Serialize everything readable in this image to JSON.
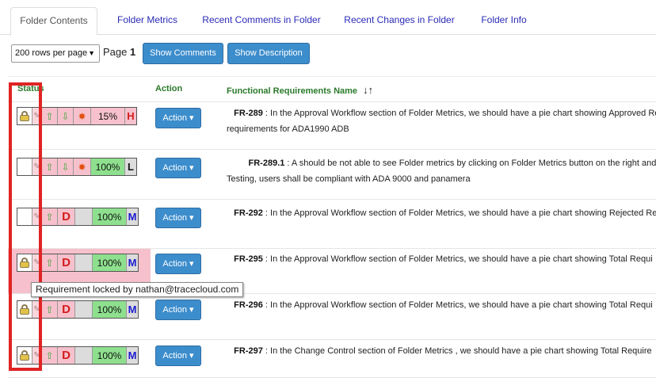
{
  "tabs": [
    {
      "label": "Folder Contents",
      "active": true
    },
    {
      "label": "Folder Metrics"
    },
    {
      "label": "Recent Comments in Folder"
    },
    {
      "label": "Recent Changes in Folder"
    },
    {
      "label": "Folder Info"
    }
  ],
  "toolbar": {
    "rows_per_page": "200 rows per page",
    "page_label": "Page",
    "page_number": "1",
    "show_comments": "Show Comments",
    "show_description": "Show Description"
  },
  "columns": {
    "status": "Status",
    "action": "Action",
    "name": "Functional Requirements Name",
    "sort_icon": "↓↑"
  },
  "rows": [
    {
      "id": "FR-289",
      "text": " : In the Approval Workflow section of Folder Metrics, we should have a pie chart showing Approved Re. s",
      "text2": "requirements for ADA1990 ADB",
      "percent": "15%",
      "priority": "H",
      "action": "Action"
    },
    {
      "id": "FR-289.1",
      "text": " : A should be not able to see Folder metrics by clicking on Folder Metrics button on the right and th",
      "text2": "Testing, users shall be compliant with ADA 9000 and panamera",
      "percent": "100%",
      "priority": "L",
      "action": "Action"
    },
    {
      "id": "FR-292",
      "text": " : In the Approval Workflow section of Folder Metrics, we should have a pie chart showing Rejected Redo",
      "percent": "100%",
      "priority": "M",
      "status_letter": "D",
      "action": "Action"
    },
    {
      "id": "FR-295",
      "text": " : In the Approval Workflow section of Folder Metrics, we should have a pie chart showing Total Requi",
      "percent": "100%",
      "priority": "M",
      "status_letter": "D",
      "action": "Action"
    },
    {
      "id": "FR-296",
      "text": " : In the Approval Workflow section of Folder Metrics, we should have a pie chart showing Total Requi",
      "percent": "100%",
      "priority": "M",
      "status_letter": "D",
      "action": "Action"
    },
    {
      "id": "FR-297",
      "text": " : In the Change Control section of Folder Metrics , we should have a pie chart showing Total Require",
      "percent": "100%",
      "priority": "M",
      "status_letter": "D",
      "action": "Action"
    }
  ],
  "tooltip": "Requirement locked by nathan@tracecloud.com",
  "colors": {
    "accent_blue": "#3c8dcc",
    "highlight_red": "#e02424",
    "pink": "#f6c1cc",
    "green": "#8ee08e"
  }
}
